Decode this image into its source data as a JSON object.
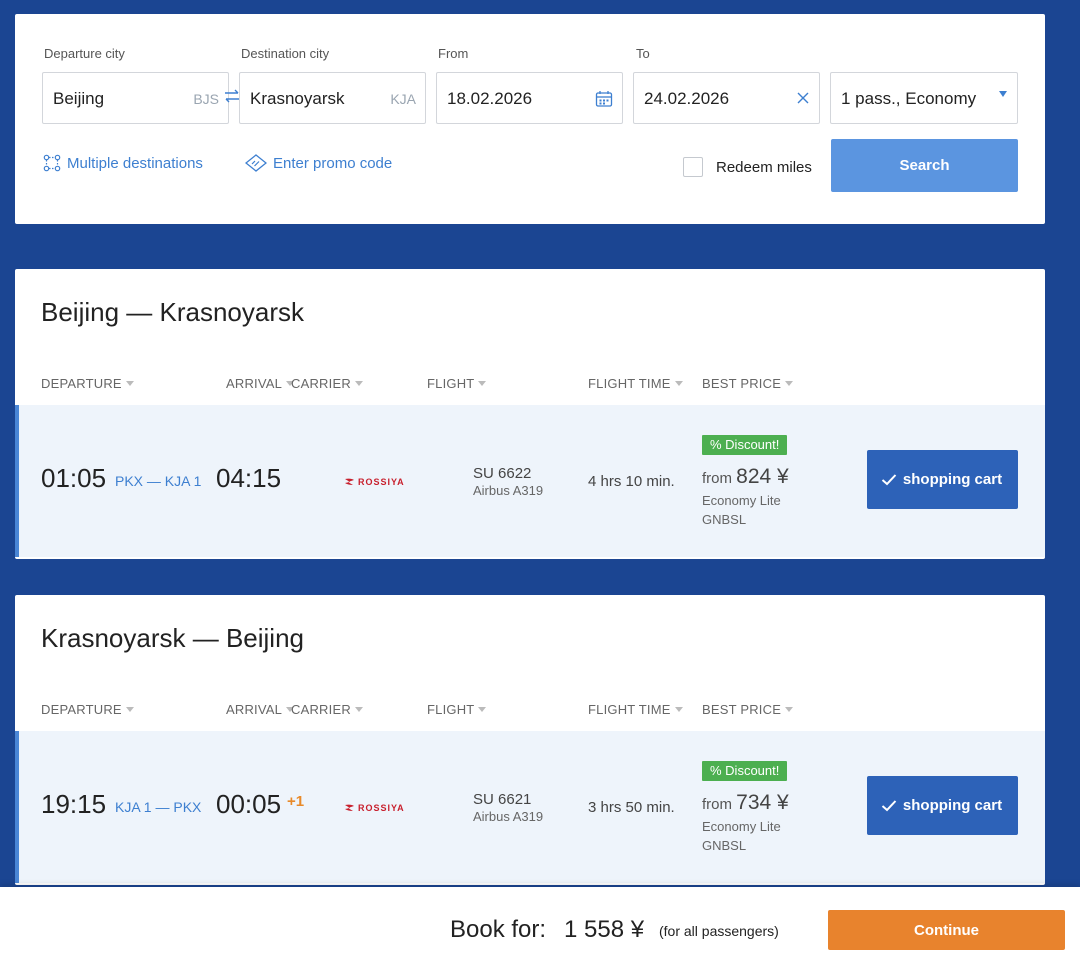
{
  "search": {
    "departure_label": "Departure city",
    "departure_value": "Beijing",
    "departure_code": "BJS",
    "destination_label": "Destination city",
    "destination_value": "Krasnoyarsk",
    "destination_code": "KJA",
    "from_label": "From",
    "from_value": "18.02.2026",
    "to_label": "To",
    "to_value": "24.02.2026",
    "passengers_value": "1 pass., Economy",
    "multiple_destinations": "Multiple destinations",
    "promo_code": "Enter promo code",
    "redeem_miles": "Redeem miles",
    "search_button": "Search"
  },
  "columns": {
    "departure": "DEPARTURE",
    "arrival": "ARRIVAL",
    "carrier": "CARRIER",
    "flight": "FLIGHT",
    "flight_time": "FLIGHT TIME",
    "best_price": "BEST PRICE"
  },
  "routes": [
    {
      "title": "Beijing — Krasnoyarsk",
      "flight": {
        "dep_time": "01:05",
        "airports": "PKX — KJA 1",
        "arr_time": "04:15",
        "plus_day": "",
        "carrier": "ROSSIYA",
        "flight_number": "SU 6622",
        "aircraft": "Airbus A319",
        "flight_time": "4 hrs 10 min.",
        "discount": "% Discount!",
        "price_prefix": "from",
        "price": "824 ¥",
        "fare": "Economy Lite GNBSL",
        "cart_label": "shopping cart"
      }
    },
    {
      "title": "Krasnoyarsk — Beijing",
      "flight": {
        "dep_time": "19:15",
        "airports": "KJA 1 — PKX",
        "arr_time": "00:05",
        "plus_day": "+1",
        "carrier": "ROSSIYA",
        "flight_number": "SU 6621",
        "aircraft": "Airbus A319",
        "flight_time": "3 hrs 50 min.",
        "discount": "% Discount!",
        "price_prefix": "from",
        "price": "734 ¥",
        "fare": "Economy Lite GNBSL",
        "cart_label": "shopping cart"
      }
    }
  ],
  "booking": {
    "label": "Book for:",
    "total": "1 558 ¥",
    "note": "(for all passengers)",
    "continue_button": "Continue"
  },
  "colors": {
    "background": "#1b4592",
    "accent": "#3d7fd0",
    "search_button": "#5b95e0",
    "cart_button": "#2d62b8",
    "continue_button": "#e8832d",
    "discount": "#4caf50",
    "carrier_logo": "#c8202d"
  },
  "icons": {
    "swap": "swap-arrows-icon",
    "calendar": "calendar-icon",
    "clear": "close-icon",
    "dropdown": "caret-down-icon",
    "multi": "multi-route-icon",
    "promo": "ticket-icon",
    "check": "check-icon",
    "carrier_logo": "rossiya-logo-icon"
  }
}
